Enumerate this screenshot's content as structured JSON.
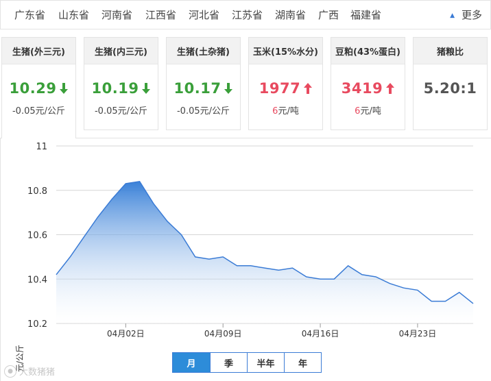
{
  "tabs": [
    "广东省",
    "山东省",
    "河南省",
    "江西省",
    "河北省",
    "江苏省",
    "湖南省",
    "广西",
    "福建省"
  ],
  "more_label": "更多",
  "cards": [
    {
      "name": "生猪(外三元)",
      "price": "10.29",
      "trend": "down",
      "change": "-0.05元/公斤",
      "active": true
    },
    {
      "name": "生猪(内三元)",
      "price": "10.19",
      "trend": "down",
      "change": "-0.05元/公斤"
    },
    {
      "name": "生猪(土杂猪)",
      "price": "10.17",
      "trend": "down",
      "change": "-0.05元/公斤"
    },
    {
      "name": "玉米(15%水分)",
      "price": "1977",
      "trend": "up",
      "change_value": "6",
      "change_unit": "元/吨"
    },
    {
      "name": "豆粕(43%蛋白)",
      "price": "3419",
      "trend": "up",
      "change_value": "6",
      "change_unit": "元/吨"
    },
    {
      "name": "猪粮比",
      "price": "5.20:1",
      "trend": "none"
    }
  ],
  "colors": {
    "down": "#3a9f3a",
    "up": "#e84a5f",
    "neutral": "#555555",
    "series_line": "#3a7bd5",
    "area_top": "#2f7ad6",
    "accent": "#2d8cd9"
  },
  "chart_data": {
    "type": "area",
    "ylabel": "元/公斤",
    "ylim": [
      10.2,
      11
    ],
    "yticks": [
      "10.2",
      "10.4",
      "10.6",
      "10.8",
      "11"
    ],
    "xticks": [
      {
        "label": "04月02日",
        "day": 2
      },
      {
        "label": "04月09日",
        "day": 9
      },
      {
        "label": "04月16日",
        "day": 16
      },
      {
        "label": "04月23日",
        "day": 23
      }
    ],
    "x_days": [
      -3,
      -2,
      -1,
      0,
      1,
      2,
      3,
      4,
      5,
      6,
      7,
      8,
      9,
      10,
      11,
      12,
      13,
      14,
      15,
      16,
      17,
      18,
      19,
      20,
      21,
      22,
      23,
      24,
      25,
      26,
      27
    ],
    "values": [
      10.42,
      10.5,
      10.59,
      10.68,
      10.76,
      10.83,
      10.84,
      10.74,
      10.66,
      10.6,
      10.5,
      10.49,
      10.5,
      10.46,
      10.46,
      10.45,
      10.44,
      10.45,
      10.41,
      10.4,
      10.4,
      10.46,
      10.42,
      10.41,
      10.38,
      10.36,
      10.35,
      10.3,
      10.3,
      10.34,
      10.29
    ],
    "grid": true
  },
  "periods": [
    "月",
    "季",
    "半年",
    "年"
  ],
  "active_period": "月",
  "watermark": "大数猪猪"
}
